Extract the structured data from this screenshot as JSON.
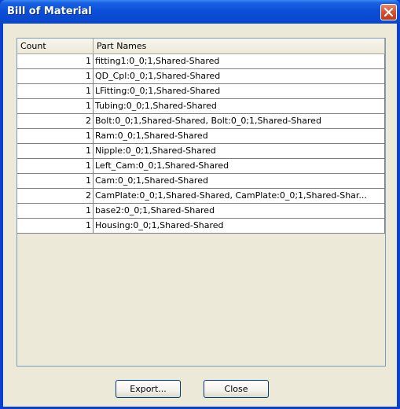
{
  "window": {
    "title": "Bill of Material"
  },
  "table": {
    "columns": [
      "Count",
      "Part Names"
    ],
    "rows": [
      {
        "count": "1",
        "parts": "fitting1:0_0;1,Shared-Shared"
      },
      {
        "count": "1",
        "parts": "QD_Cpl:0_0;1,Shared-Shared"
      },
      {
        "count": "1",
        "parts": "LFitting:0_0;1,Shared-Shared"
      },
      {
        "count": "1",
        "parts": "Tubing:0_0;1,Shared-Shared"
      },
      {
        "count": "2",
        "parts": "Bolt:0_0;1,Shared-Shared, Bolt:0_0;1,Shared-Shared"
      },
      {
        "count": "1",
        "parts": "Ram:0_0;1,Shared-Shared"
      },
      {
        "count": "1",
        "parts": "Nipple:0_0;1,Shared-Shared"
      },
      {
        "count": "1",
        "parts": "Left_Cam:0_0;1,Shared-Shared"
      },
      {
        "count": "1",
        "parts": "Cam:0_0;1,Shared-Shared"
      },
      {
        "count": "2",
        "parts": "CamPlate:0_0;1,Shared-Shared, CamPlate:0_0;1,Shared-Shar..."
      },
      {
        "count": "1",
        "parts": "base2:0_0;1,Shared-Shared"
      },
      {
        "count": "1",
        "parts": "Housing:0_0;1,Shared-Shared"
      }
    ]
  },
  "buttons": {
    "export_label": "Export...",
    "close_label": "Close"
  },
  "icons": {
    "close": "close-icon"
  },
  "colors": {
    "titlebar": "#0a49d0",
    "close_button": "#d8502d",
    "dialog_background": "#ece9d8"
  }
}
